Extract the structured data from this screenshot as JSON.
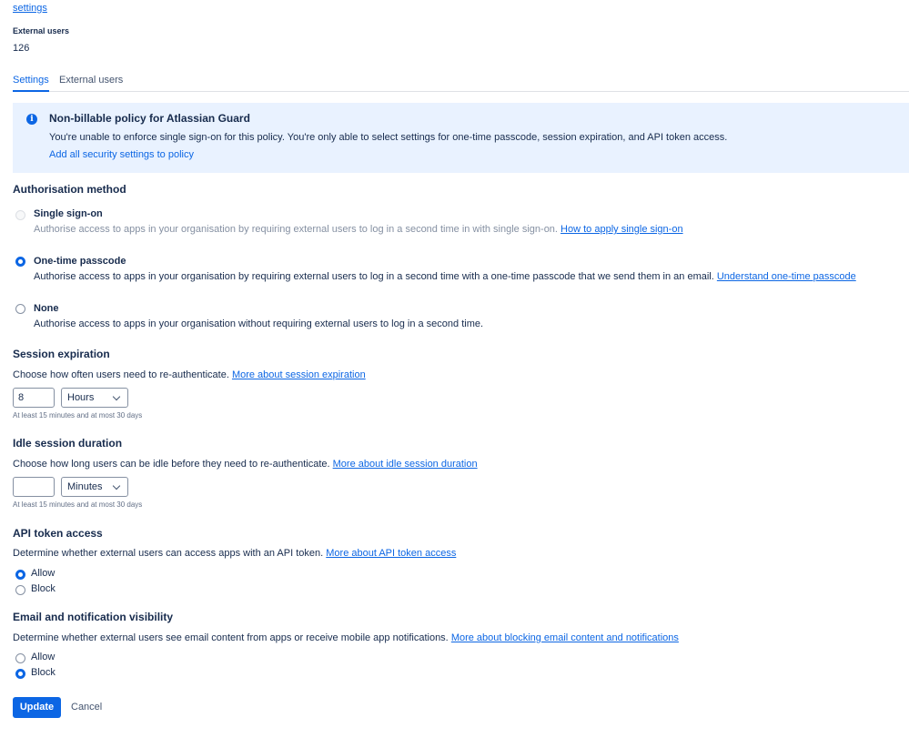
{
  "header": {
    "top_link": "settings",
    "external_users_label": "External users",
    "external_users_count": "126"
  },
  "tabs": [
    {
      "label": "Settings",
      "active": true
    },
    {
      "label": "External users",
      "active": false
    }
  ],
  "banner": {
    "icon": "info-icon",
    "title": "Non-billable policy for Atlassian Guard",
    "description": "You're unable to enforce single sign-on for this policy. You're only able to select settings for one-time passcode, session expiration, and API token access.",
    "link": "Add all security settings to policy"
  },
  "auth": {
    "heading": "Authorisation method",
    "options": [
      {
        "title": "Single sign-on",
        "desc": "Authorise access to apps in your organisation by requiring external users to log in a second time in with single sign-on.",
        "link": "How to apply single sign-on",
        "state": "disabled"
      },
      {
        "title": "One-time passcode",
        "desc": "Authorise access to apps in your organisation by requiring external users to log in a second time with a one-time passcode that we send them in an email.",
        "link": "Understand one-time passcode",
        "state": "checked"
      },
      {
        "title": "None",
        "desc": "Authorise access to apps in your organisation without requiring external users to log in a second time.",
        "link": "",
        "state": "unchecked"
      }
    ]
  },
  "session": {
    "heading": "Session expiration",
    "desc": "Choose how often users need to re-authenticate.",
    "link": "More about session expiration",
    "value": "8",
    "unit": "Hours",
    "hint": "At least 15 minutes and at most 30 days"
  },
  "idle": {
    "heading": "Idle session duration",
    "desc": "Choose how long users can be idle before they need to re-authenticate.",
    "link": "More about idle session duration",
    "value": "",
    "unit": "Minutes",
    "hint": "At least 15 minutes and at most 30 days"
  },
  "api": {
    "heading": "API token access",
    "desc": "Determine whether external users can access apps with an API token.",
    "link": "More about API token access",
    "options": [
      {
        "label": "Allow",
        "checked": true
      },
      {
        "label": "Block",
        "checked": false
      }
    ]
  },
  "email": {
    "heading": "Email and notification visibility",
    "desc": "Determine whether external users see email content from apps or receive mobile app notifications.",
    "link": "More about blocking email content and notifications",
    "options": [
      {
        "label": "Allow",
        "checked": false
      },
      {
        "label": "Block",
        "checked": true
      }
    ]
  },
  "actions": {
    "update": "Update",
    "cancel": "Cancel"
  },
  "colors": {
    "primary": "#0c66e4",
    "banner_bg": "#e9f2ff",
    "text": "#172b4d"
  }
}
